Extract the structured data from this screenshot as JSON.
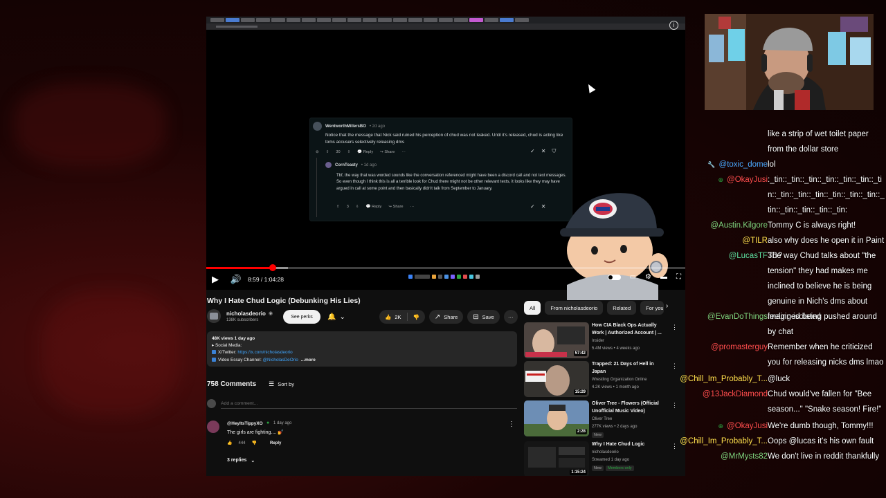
{
  "video": {
    "title": "Why I Hate Chud Logic (Debunking His Lies)",
    "time_display": "8:59 / 1:04:28",
    "progress_fraction": 0.139,
    "buffered_fraction": 0.17
  },
  "reddit": {
    "comment1": {
      "author": "WentworthMillersBO",
      "time": "• 2d ago",
      "body": "Notice that the message that Nick said ruined his perception of chud was not leaked. Until it's released, chud is acting like toms accusers selectively releasing dms",
      "votes": "30",
      "reply": "Reply",
      "share": "Share"
    },
    "comment2": {
      "author": "CornToasty",
      "time": "• 1d ago",
      "body": "Tbf, the way that was worded sounds like the conversation referenced might have been a discord call and not text messages. So even though I think this is all a terrible look for Chud there might not be other relevant texts, it looks like they may have argued in call at some point and then basically didn't talk from September to January.",
      "votes": "3",
      "reply": "Reply",
      "share": "Share"
    }
  },
  "channel": {
    "name": "nicholasdeorio",
    "subscribers": "138K subscribers",
    "perks_label": "See perks"
  },
  "actions": {
    "likes": "2K",
    "share": "Share",
    "save": "Save"
  },
  "description": {
    "meta": "48K views  1 day ago",
    "line1": "▸ Social Media:",
    "twitter_label": "X/Twitter:",
    "twitter_url": "https://x.com/nicholasdeorio",
    "essay_label": "Video Essay Channel:",
    "essay_handle": "@NicholasDeOrio",
    "more": "...more"
  },
  "comments": {
    "count": "758 Comments",
    "sort_label": "Sort by",
    "placeholder": "Add a comment...",
    "first": {
      "author": "@HeyItsTippyXO",
      "time": "1 day ago",
      "text": "The girls are fighting.... 💅",
      "likes": "444",
      "reply": "Reply",
      "replies": "3 replies"
    }
  },
  "chips": [
    "All",
    "From nicholasdeorio",
    "Related",
    "For you"
  ],
  "related": [
    {
      "title": "How CIA Black Ops Actually Work | Authorized Account | ...",
      "channel": "Insider",
      "meta": "5.4M views • 4 weeks ago",
      "duration": "57:42",
      "thumb_color": "#5a4a44"
    },
    {
      "title": "Trapped: 21 Days of Hell in Japan",
      "channel": "Wrestling Organization Online",
      "meta": "4.2K views • 1 month ago",
      "duration": "15:29",
      "thumb_color": "#3d3b38"
    },
    {
      "title": "Oliver Tree - Flowers (Official Unofficial Music Video)",
      "channel": "Oliver Tree",
      "meta": "277K views • 2 days ago",
      "duration": "2:28",
      "badge": "New",
      "thumb_color": "#6d8eb5"
    },
    {
      "title": "Why I Hate Chud Logic",
      "channel": "nicholasdeorio",
      "meta": "Streamed 1 day ago",
      "duration": "1:15:24",
      "badge": "New",
      "badge2": "Members only",
      "thumb_color": "#151515"
    }
  ],
  "chat": [
    {
      "user": "",
      "text": "like a strip of wet toilet paper from the dollar store",
      "color": "#ffffff"
    },
    {
      "user": "@toxic_dome",
      "text": "lol",
      "color": "#4aa8ff",
      "icon": "🔧"
    },
    {
      "user": "@OkayJusi",
      "text": ":_tin::_tin::_tin::_tin::_tin::_tin::_tin::_tin::_tin::_tin::_tin::_tin::_tin::_tin::_tin::_tin::_tin::_tin:",
      "color": "#ff4d4d",
      "icon": "⊕"
    },
    {
      "user": "@Austin.Kilgore",
      "text": "Tommy C is always right!",
      "color": "#7fd67f"
    },
    {
      "user": "@TILR",
      "text": "also why does he open it in Paint 3D?",
      "color": "#ffe14d"
    },
    {
      "user": "@LucasTF",
      "text": "The way Chud talks about \"the tension\" they had makes me inclined to believe he is being genuine in Nich's dms about feeling isolated",
      "color": "#5ee0a0"
    },
    {
      "user": "@EvanDoThings",
      "text": "imagined being pushed around by chat",
      "color": "#7fd67f"
    },
    {
      "user": "@promasterguy",
      "text": "Remember when he criticized you for releasing nicks dms lmao",
      "color": "#ff4d4d"
    },
    {
      "user": "@Chill_Im_Probably_T...",
      "text": "@luck",
      "color": "#ffe14d"
    },
    {
      "user": "@13JackDiamond",
      "text": "Chud would've fallen for \"Bee season...\" \"Snake season! Fire!\"",
      "color": "#ff4d4d"
    },
    {
      "user": "@OkayJusi",
      "text": "We're dumb though, Tommy!!!",
      "color": "#ff4d4d",
      "icon": "⊕"
    },
    {
      "user": "@Chill_Im_Probably_T...",
      "text": "Oops @lucas it's his own fault",
      "color": "#ffe14d"
    },
    {
      "user": "@MrMysts82",
      "text": "We don't live in reddit thankfully",
      "color": "#7fd67f"
    }
  ]
}
